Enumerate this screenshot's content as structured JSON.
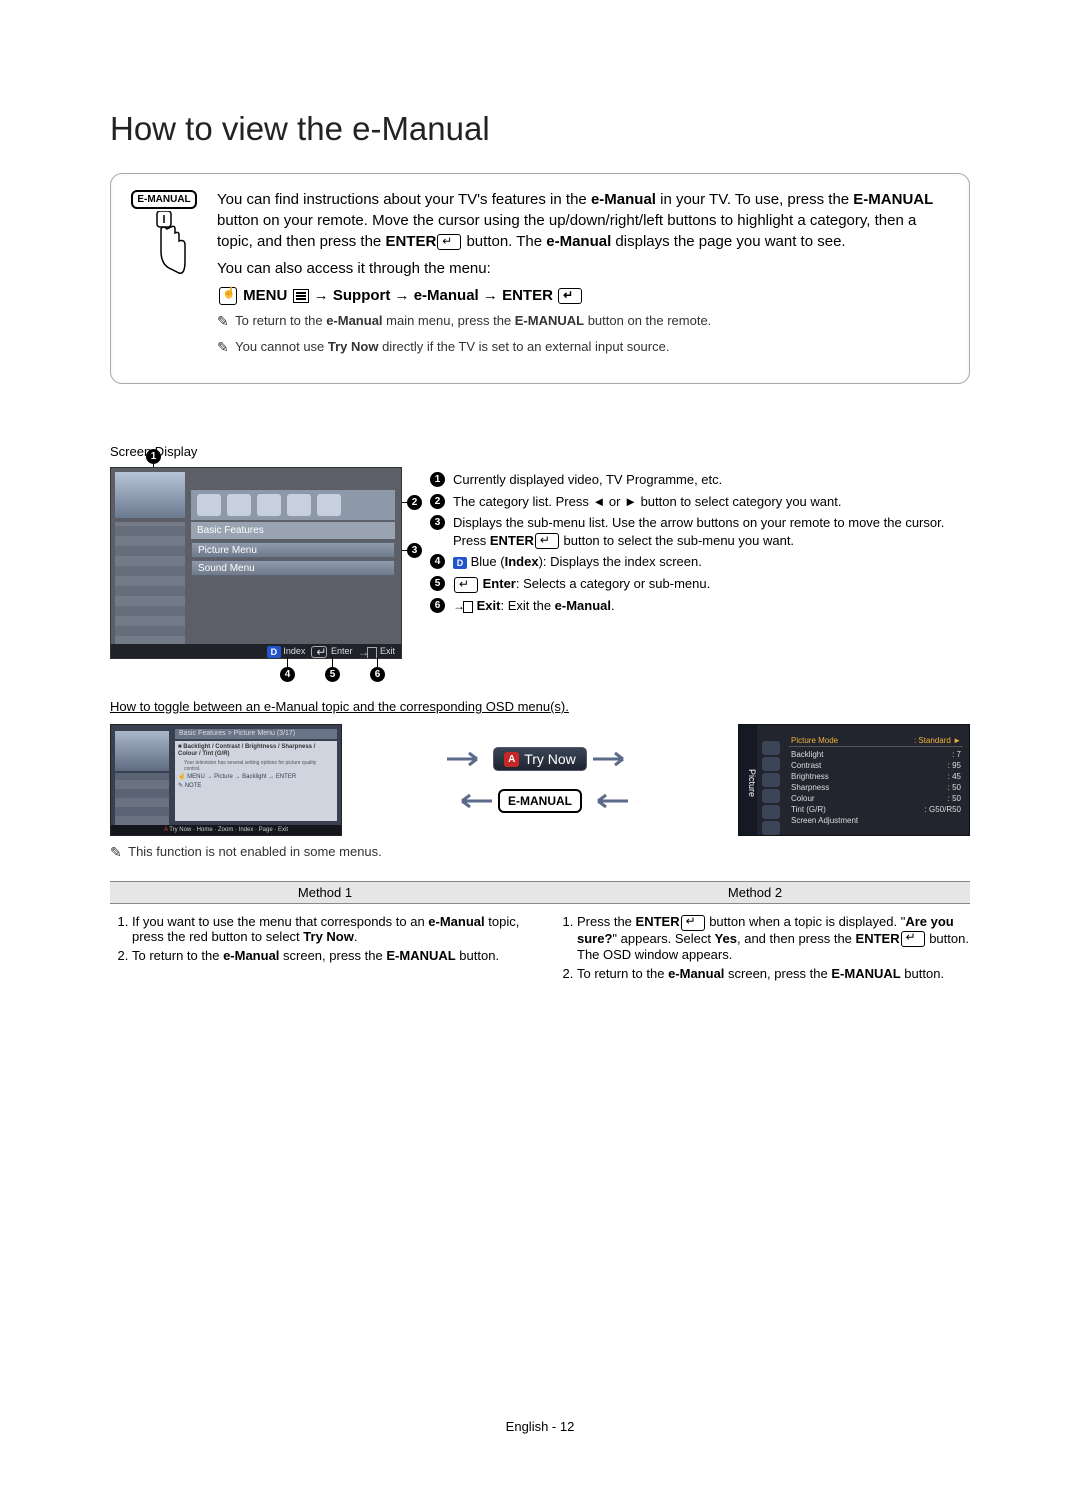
{
  "title": "How to view the e-Manual",
  "remote_button_label": "E-MANUAL",
  "intro": {
    "p1_a": "You can find instructions about your TV's features in the ",
    "p1_b": "e-Manual",
    "p1_c": " in your TV. To use, press the ",
    "p1_d": "E-MANUAL",
    "p1_e": " button on your remote. Move the cursor using the up/down/right/left buttons to highlight a category, then a topic, and then press the ",
    "p1_f": "ENTER",
    "p1_g": " button. The ",
    "p1_h": "e-Manual",
    "p1_i": " displays the page you want to see.",
    "p2": "You can also access it through the menu:"
  },
  "nav_path": {
    "menu": "MENU",
    "support": "Support",
    "emanual": "e-Manual",
    "enter": "ENTER"
  },
  "notes": {
    "n1_a": "To return to the ",
    "n1_b": "e-Manual",
    "n1_c": " main menu, press the ",
    "n1_d": "E-MANUAL",
    "n1_e": " button on the remote.",
    "n2_a": "You cannot use ",
    "n2_b": "Try Now",
    "n2_c": " directly if the TV is set to an external input source."
  },
  "screen_display_label": "Screen Display",
  "screen_mock": {
    "category_label": "Basic Features",
    "sub1": "Picture Menu",
    "sub2": "Sound Menu",
    "footer_index": "Index",
    "footer_enter": "Enter",
    "footer_exit": "Exit"
  },
  "legend": {
    "l1": "Currently displayed video, TV Programme, etc.",
    "l2": "The category list. Press ◄ or ► button to select category you want.",
    "l3_a": "Displays the sub-menu list. Use the arrow buttons on your remote to move the cursor. Press ",
    "l3_b": "ENTER",
    "l3_c": " button to select the sub-menu you want.",
    "l4_a": "Blue (",
    "l4_b": "Index",
    "l4_c": "): Displays the index screen.",
    "l5_a": "Enter",
    "l5_b": ": Selects a category or sub-menu.",
    "l6_a": "Exit",
    "l6_b": ": Exit the ",
    "l6_c": "e-Manual",
    "l6_d": "."
  },
  "toggle_heading": "How to toggle between an e-Manual topic and the corresponding OSD menu(s).",
  "mini_left": {
    "crumb": "Basic Features > Picture Menu (3/17)",
    "body_title": "Backlight / Contrast / Brightness / Sharpness / Colour / Tint (G/R)",
    "body_sub": "Your television has several setting options for picture quality control.",
    "body_path": "MENU → Picture → Backlight → ENTER",
    "body_note_lbl": "NOTE",
    "foot": "Try Now · Home · Zoom · Index · Page · Exit"
  },
  "arrows": {
    "try_now": "Try Now",
    "emanual": "E-MANUAL"
  },
  "osd": {
    "side": "Picture",
    "rows": [
      {
        "k": "Picture Mode",
        "v": ": Standard",
        "arrow": "►"
      },
      {
        "k": "Backlight",
        "v": ": 7"
      },
      {
        "k": "Contrast",
        "v": ": 95"
      },
      {
        "k": "Brightness",
        "v": ": 45"
      },
      {
        "k": "Sharpness",
        "v": ": 50"
      },
      {
        "k": "Colour",
        "v": ": 50"
      },
      {
        "k": "Tint (G/R)",
        "v": ": G50/R50"
      },
      {
        "k": "Screen Adjustment",
        "v": ""
      }
    ]
  },
  "toggle_note": "This function is not enabled in some menus.",
  "methods_header": {
    "m1": "Method 1",
    "m2": "Method 2"
  },
  "method1": {
    "s1_a": "If you want to use the menu that corresponds to an ",
    "s1_b": "e-Manual",
    "s1_c": " topic, press the red button to select ",
    "s1_d": "Try Now",
    "s1_e": ".",
    "s2_a": "To return to the ",
    "s2_b": "e-Manual",
    "s2_c": " screen, press the ",
    "s2_d": "E-MANUAL",
    "s2_e": " button."
  },
  "method2": {
    "s1_a": "Press the ",
    "s1_b": "ENTER",
    "s1_c": " button when a topic is displayed. \"",
    "s1_d": "Are you sure?",
    "s1_e": "\" appears. Select ",
    "s1_f": "Yes",
    "s1_g": ", and then press the ",
    "s1_h": "ENTER",
    "s1_i": " button. The OSD window appears.",
    "s2_a": "To return to the ",
    "s2_b": "e-Manual",
    "s2_c": " screen, press the ",
    "s2_d": "E-MANUAL",
    "s2_e": " button."
  },
  "footer": "English - 12"
}
